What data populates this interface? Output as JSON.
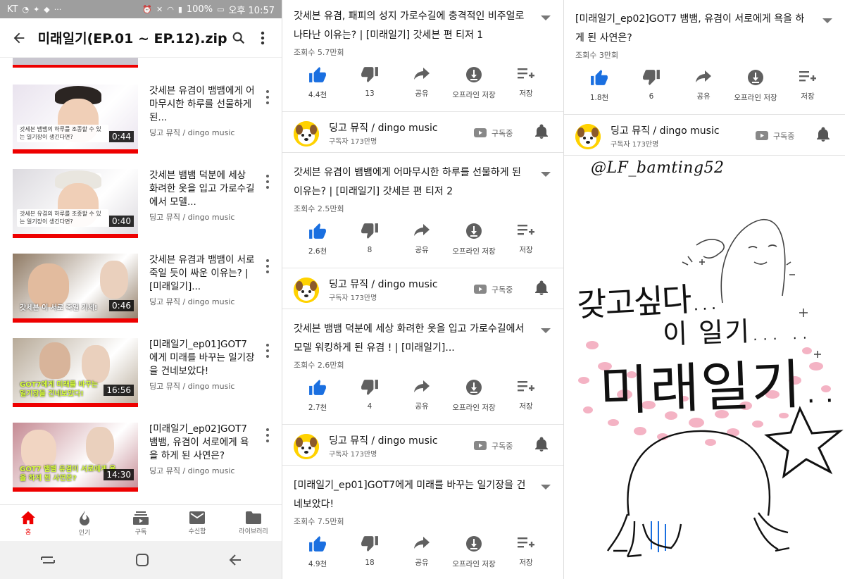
{
  "panel1": {
    "status_bar": {
      "carrier": "KT",
      "battery": "100%",
      "time": "오후 10:57"
    },
    "app_bar": {
      "title": "미래일기(EP.01 ~ EP.12).zip"
    },
    "playlist": [
      {
        "title": "갓세븐 유겸이 뱀뱀에게 어마무시한 하루를 선물하게 된...",
        "channel": "딩고 뮤직 / dingo music",
        "duration": "0:44",
        "thumb_caption": "갓세븐 뱀뱀의 하루를 조종할 수 있는 일기장이 생긴다면?",
        "thumb_color": "#e9e3ee"
      },
      {
        "title": "갓세븐 뱀뱀 덕분에 세상 화려한 옷을 입고 가로수길에서 모델...",
        "channel": "딩고 뮤직 / dingo music",
        "duration": "0:40",
        "thumb_caption": "갓세븐 유겸의 하루를 조종할 수 있는 일기장이 생긴다면?",
        "thumb_color": "#dcdadf"
      },
      {
        "title": "갓세븐 유겸과 뱀뱀이 서로 죽일 듯이 싸운 이유는? | [미래일기]...",
        "channel": "딩고 뮤직 / dingo music",
        "duration": "0:46",
        "thumb_caption": "갓세븐 이 서로 죽일 기세!",
        "thumb_color": "#8f7a64"
      },
      {
        "title": "[미래일기_ep01]GOT7에게 미래를 바꾸는 일기장을 건네보았다!",
        "channel": "딩고 뮤직 / dingo music",
        "duration": "16:56",
        "thumb_caption": "GOT7에게 미래를 바꾸는 일기장을 건네보았다!",
        "thumb_color": "#b7aa98"
      },
      {
        "title": "[미래일기_ep02]GOT7 뱀뱀, 유겸이 서로에게 욕을 하게 된 사연은?",
        "channel": "딩고 뮤직 / dingo music",
        "duration": "14:30",
        "thumb_caption": "GOT7 뱀뱀 유겸이 서로에게 욕을 하게 된 사연은?",
        "thumb_color": "#c58a93"
      }
    ],
    "bottom_nav": [
      {
        "label": "홈",
        "icon": "home-icon",
        "active": true
      },
      {
        "label": "인기",
        "icon": "trending-icon",
        "active": false
      },
      {
        "label": "구독",
        "icon": "subscriptions-icon",
        "active": false
      },
      {
        "label": "수신함",
        "icon": "inbox-icon",
        "active": false
      },
      {
        "label": "라이브러리",
        "icon": "library-icon",
        "active": false
      }
    ]
  },
  "panel2": {
    "videos": [
      {
        "title": "갓세븐 유겸, 패피의 성지 가로수길에 충격적인 비주얼로 나타난 이유는? | [미래일기] 갓세븐 편 티저 1",
        "views": "조회수 5.7만회",
        "likes": "4.4천",
        "dislikes": "13"
      },
      {
        "title": "갓세븐 유겸이 뱀뱀에게 어마무시한 하루를 선물하게 된 이유는? | [미래일기] 갓세븐 편 티저 2",
        "views": "조회수 2.5만회",
        "likes": "2.6천",
        "dislikes": "8"
      },
      {
        "title": "갓세븐 뱀뱀 덕분에 세상 화려한 옷을 입고 가로수길에서 모델 워킹하게 된 유겸 ! | [미래일기]...",
        "views": "조회수 2.6만회",
        "likes": "2.7천",
        "dislikes": "4"
      },
      {
        "title": "[미래일기_ep01]GOT7에게 미래를 바꾸는 일기장을 건네보았다!",
        "views": "조회수 7.5만회",
        "likes": "4.9천",
        "dislikes": "18"
      }
    ]
  },
  "panel3": {
    "video": {
      "title": "[미래일기_ep02]GOT7 뱀뱀, 유겸이 서로에게 욕을 하게 된 사연은?",
      "views": "조회수 3만회",
      "likes": "1.8천",
      "dislikes": "6"
    },
    "drawing": {
      "handle": "@LF_bamting52",
      "line1": "갖고싶다...",
      "line2": "이 일기... ..",
      "line3": "미래일기.."
    }
  },
  "actions": {
    "share": "공유",
    "offline": "오프라인 저장",
    "save": "저장"
  },
  "channel": {
    "name": "딩고 뮤직 / dingo music",
    "subs": "구독자 173만명",
    "subscribed_label": "구독중"
  },
  "colors": {
    "youtube_red": "#ee0000",
    "like_blue": "#1a6fe0",
    "dingo_yellow": "#ffd200"
  }
}
